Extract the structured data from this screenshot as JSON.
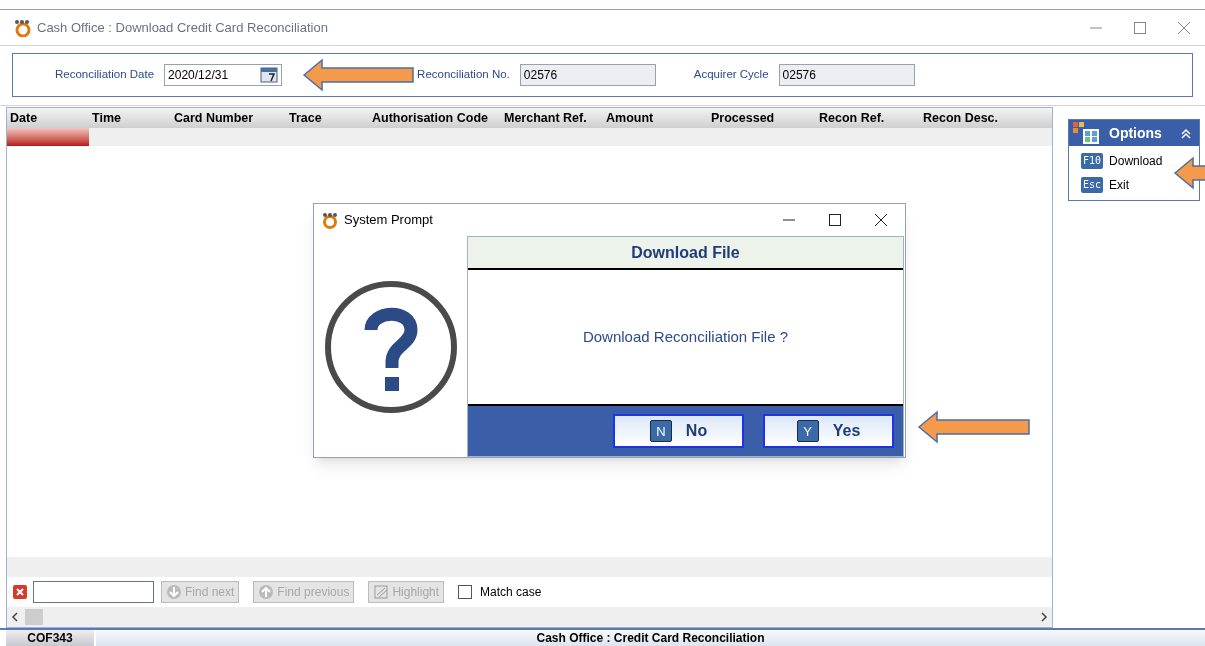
{
  "window": {
    "title": "Cash Office : Download Credit Card Reconciliation"
  },
  "header_fields": [
    {
      "label": "Reconciliation Date",
      "value": "2020/12/31",
      "kind": "date"
    },
    {
      "label": "Reconciliation No.",
      "value": "02576",
      "kind": "readonly"
    },
    {
      "label": "Acquirer Cycle",
      "value": "02576",
      "kind": "readonly"
    }
  ],
  "table": {
    "columns": [
      "Date",
      "Time",
      "Card Number",
      "Trace",
      "Authorisation Code",
      "Merchant Ref.",
      "Amount",
      "Processed",
      "Recon Ref.",
      "Recon Desc."
    ]
  },
  "options_panel": {
    "title": "Options",
    "expanded": true,
    "items": [
      {
        "key": "F10",
        "label": "Download"
      },
      {
        "key": "Esc",
        "label": "Exit"
      }
    ]
  },
  "dialog": {
    "title": "System Prompt",
    "heading": "Download File",
    "message": "Download Reconciliation File ?",
    "buttons": [
      {
        "key": "N",
        "label": "No"
      },
      {
        "key": "Y",
        "label": "Yes"
      }
    ]
  },
  "find_bar": {
    "buttons": [
      {
        "label": "Find next",
        "kind": "down",
        "disabled": true
      },
      {
        "label": "Find previous",
        "kind": "up",
        "disabled": true
      },
      {
        "label": "Highlight",
        "kind": "highlight",
        "disabled": true
      }
    ],
    "match_case": {
      "label": "Match case",
      "checked": false
    }
  },
  "status_bar": {
    "code": "COF343",
    "title": "Cash Office : Credit Card Reconciliation"
  }
}
